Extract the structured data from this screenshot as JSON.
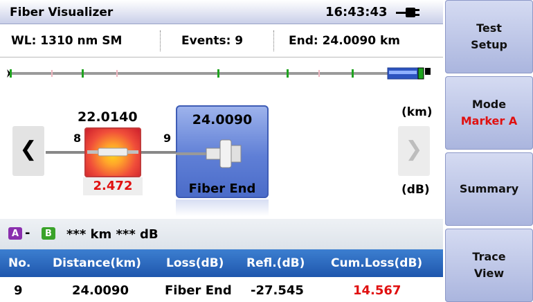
{
  "header": {
    "title": "Fiber Visualizer",
    "time": "16:43:43"
  },
  "info": {
    "wavelength": "WL: 1310 nm SM",
    "events": "Events: 9",
    "end": "End: 24.0090 km"
  },
  "visual": {
    "event1_distance": "22.0140",
    "event1_loss": "2.472",
    "event1_left_index": "8",
    "event2_left_index": "9",
    "event2_distance": "24.0090",
    "event2_label": "Fiber End",
    "unit_distance": "(km)",
    "unit_loss": "(dB)"
  },
  "ab": {
    "marker_a": "A",
    "marker_b": "B",
    "dash": "-",
    "value": "*** km  *** dB"
  },
  "table": {
    "headers": [
      "No.",
      "Distance(km)",
      "Loss(dB)",
      "Refl.(dB)",
      "Cum.Loss(dB)"
    ],
    "row": [
      "9",
      "24.0090",
      "Fiber End",
      "-27.545",
      "14.567"
    ]
  },
  "sidebar": {
    "test_setup": [
      "Test",
      "Setup"
    ],
    "mode": [
      "Mode",
      "Marker A"
    ],
    "summary": "Summary",
    "trace_view": [
      "Trace",
      "View"
    ]
  },
  "colors": {
    "accent_red": "#e01010",
    "header_blue": "#1f57ad",
    "sidebar_button": "#aab5de"
  },
  "icons": {
    "power": "plug-icon",
    "nav_left": "chevron-left-icon",
    "nav_right": "chevron-right-icon"
  }
}
